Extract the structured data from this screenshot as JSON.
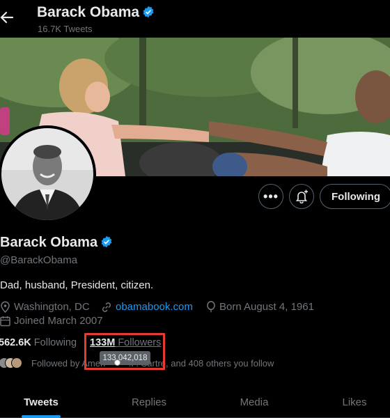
{
  "header": {
    "name": "Barack Obama",
    "tweet_count": "16.7K Tweets"
  },
  "actions": {
    "more_label": "•••",
    "follow_label": "Following"
  },
  "profile": {
    "name": "Barack Obama",
    "handle": "@BarackObama",
    "bio": "Dad, husband, President, citizen.",
    "location": "Washington, DC",
    "website": "obamabook.com",
    "birthday": "Born August 4, 1961",
    "joined": "Joined March 2007"
  },
  "stats": {
    "following_count": "562.6K",
    "following_label": "Following",
    "followers_count": "133M",
    "followers_label": "Followers",
    "followers_tooltip": "133,042,018"
  },
  "followed_by": "Followed by Ameri••• • • .P. Sartre, and 408 others you follow",
  "tabs": [
    "Tweets",
    "Replies",
    "Media",
    "Likes"
  ],
  "colors": {
    "accent": "#1d9bf0",
    "background": "#000000",
    "highlight_box": "#e53b30"
  }
}
